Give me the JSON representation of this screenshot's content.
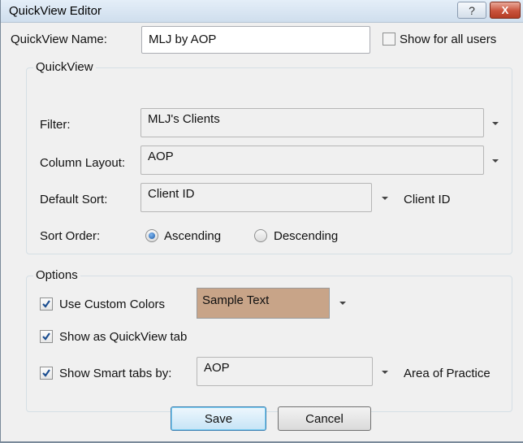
{
  "window": {
    "title": "QuickView Editor",
    "help_glyph": "?",
    "close_glyph": "X"
  },
  "name_row": {
    "label": "QuickView Name:",
    "value": "MLJ by AOP",
    "show_all_label": "Show for all users",
    "show_all_checked": false
  },
  "quickview_group": {
    "title": "QuickView",
    "filter_label": "Filter:",
    "filter_value": "MLJ's Clients",
    "layout_label": "Column Layout:",
    "layout_value": "AOP",
    "sort_label": "Default Sort:",
    "sort_value": "Client ID",
    "sort_secondary": "Client ID",
    "order_label": "Sort Order:",
    "ascending_label": "Ascending",
    "descending_label": "Descending",
    "selected_order": "Ascending"
  },
  "options_group": {
    "title": "Options",
    "custom_colors_label": "Use Custom Colors",
    "custom_colors_checked": true,
    "sample_text": "Sample Text",
    "sample_color": "#c8a488",
    "quickview_tab_label": "Show as QuickView tab",
    "quickview_tab_checked": true,
    "smart_tabs_label": "Show Smart tabs by:",
    "smart_tabs_checked": true,
    "smart_tabs_value": "AOP",
    "smart_tabs_secondary": "Area of Practice"
  },
  "buttons": {
    "save": "Save",
    "cancel": "Cancel"
  }
}
